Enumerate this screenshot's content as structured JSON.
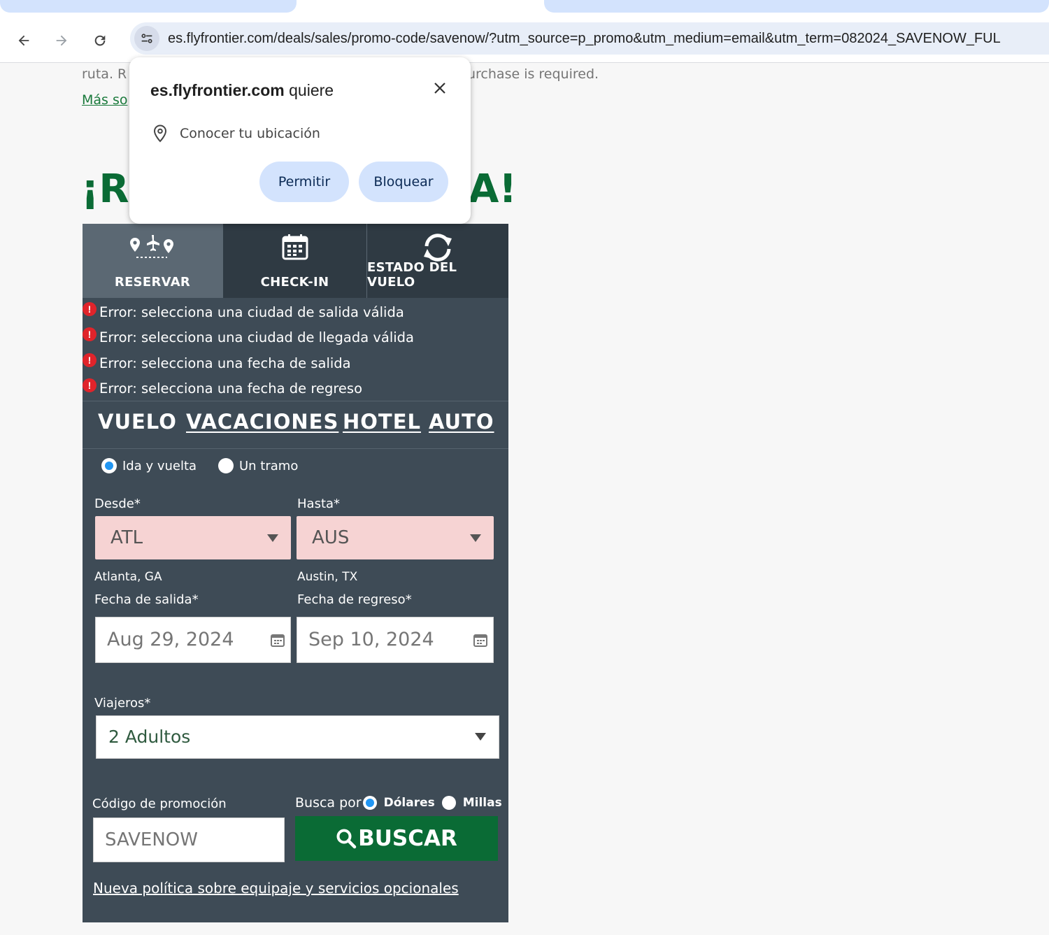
{
  "browser": {
    "url": "es.flyfrontier.com/deals/sales/promo-code/savenow/?utm_source=p_promo&utm_medium=email&utm_term=082024_SAVENOW_FUL"
  },
  "page": {
    "line1_left": "ruta. R",
    "line1_right": "urchase is required.",
    "link_partial": "Más so",
    "heading_left": "¡R",
    "heading_right": "A!"
  },
  "permission_popup": {
    "site": "es.flyfrontier.com",
    "verb": "quiere",
    "permission": "Conocer tu ubicación",
    "allow_label": "Permitir",
    "block_label": "Bloquear"
  },
  "widget": {
    "tabs": [
      {
        "label": "RESERVAR",
        "icon": "plane-route-icon"
      },
      {
        "label": "CHECK-IN",
        "icon": "calendar-icon"
      },
      {
        "label": "ESTADO DEL VUELO",
        "icon": "refresh-icon"
      }
    ],
    "errors": [
      "Error: selecciona una ciudad de salida válida",
      "Error: selecciona una ciudad de llegada válida",
      "Error: selecciona una fecha de salida",
      "Error: selecciona una fecha de regreso"
    ],
    "products": [
      "VUELO",
      "VACACIONES",
      "HOTEL",
      "AUTO"
    ],
    "trip_type": {
      "round_trip": "Ida y vuelta",
      "one_way": "Un tramo",
      "selected": "Ida y vuelta"
    },
    "from": {
      "label": "Desde*",
      "code": "ATL",
      "city": "Atlanta, GA"
    },
    "to": {
      "label": "Hasta*",
      "code": "AUS",
      "city": "Austin, TX"
    },
    "departure": {
      "label": "Fecha de salida*",
      "value": "Aug 29, 2024"
    },
    "return": {
      "label": "Fecha de regreso*",
      "value": "Sep 10, 2024"
    },
    "travelers": {
      "label": "Viajeros*",
      "value": "2 Adultos"
    },
    "promo": {
      "label": "Código de promoción",
      "value": "SAVENOW"
    },
    "search_by": {
      "label": "Busca por",
      "dollars": "Dólares",
      "miles": "Millas",
      "selected": "Dólares"
    },
    "search_label": "BUSCAR",
    "policy_link": "Nueva política sobre equipaje y servicios opcionales"
  },
  "colors": {
    "brand_green": "#0a6b35",
    "widget_bg": "#3e4b56",
    "error_red": "#e0242b",
    "invalid_field": "#f6d3d3",
    "popup_button": "#d3e3fd"
  }
}
